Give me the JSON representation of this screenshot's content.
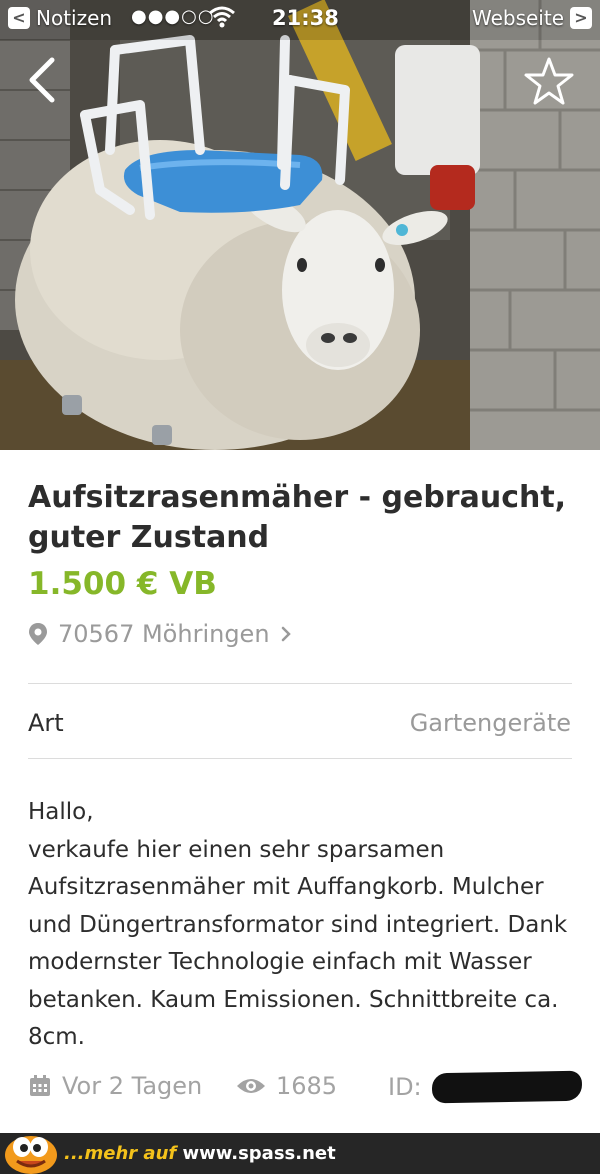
{
  "status_bar": {
    "back_app": "Notizen",
    "signal": "●●●○○",
    "time": "21:38",
    "web_link": "Webseite",
    "back_glyph": "<",
    "forward_glyph": ">"
  },
  "toolbar": {
    "back_icon": "chevron-left-icon",
    "favorite_icon": "star-outline-icon"
  },
  "listing": {
    "title": "Aufsitzrasenmäher - gebraucht, guter Zustand",
    "price": "1.500 € VB",
    "location": "70567 Möhringen",
    "attributes": [
      {
        "label": "Art",
        "value": "Gartengeräte"
      }
    ],
    "description": "Hallo,\nverkaufe hier einen sehr sparsamen Aufsitzrasenmäher mit Auffangkorb. Mulcher und Düngertransformator sind integriert. Dank modernster Technologie einfach mit Wasser betanken. Kaum Emissionen. Schnittbreite ca. 8cm.",
    "posted": "Vor 2 Tagen",
    "views": "1685",
    "id_label": "ID:"
  },
  "footer": {
    "prefix": "...mehr auf ",
    "site": "www.spass.net"
  },
  "colors": {
    "price_green": "#86b729",
    "text_dark": "#2d2d2d",
    "text_muted": "#9a9a9a",
    "footer_bg": "#262626",
    "footer_accent": "#f4c21b"
  }
}
